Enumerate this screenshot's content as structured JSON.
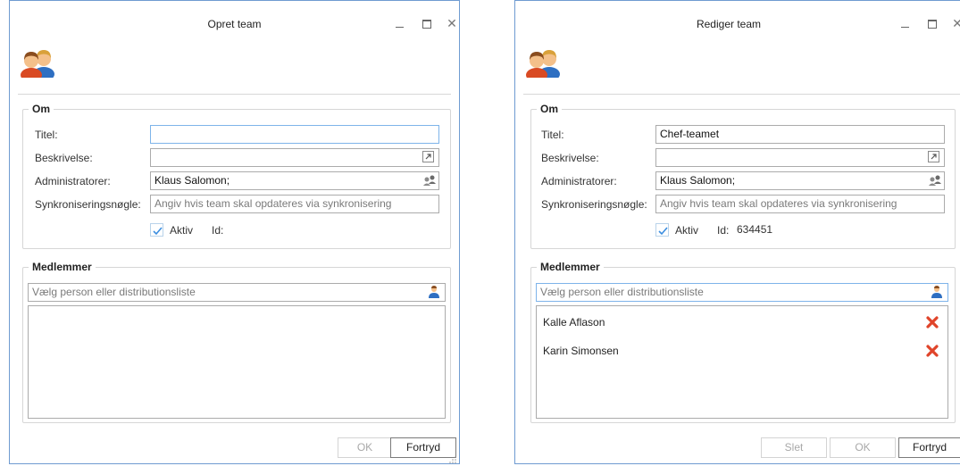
{
  "create_dialog": {
    "title": "Opret team",
    "close_glyph": "✕",
    "about": {
      "legend": "Om",
      "title_label": "Titel:",
      "title_value": "",
      "description_label": "Beskrivelse:",
      "description_value": "",
      "admins_label": "Administratorer:",
      "admins_value": "Klaus Salomon;",
      "sync_key_label": "Synkroniseringsnøgle:",
      "sync_key_placeholder": "Angiv hvis team skal opdateres via synkronisering",
      "active_label": "Aktiv",
      "active_checked": true,
      "id_label": "Id:",
      "id_value": ""
    },
    "members": {
      "legend": "Medlemmer",
      "search_placeholder": "Vælg person eller distributionsliste",
      "items": []
    },
    "buttons": {
      "ok": "OK",
      "cancel": "Fortryd"
    }
  },
  "edit_dialog": {
    "title": "Rediger team",
    "close_glyph": "✕",
    "about": {
      "legend": "Om",
      "title_label": "Titel:",
      "title_value": "Chef-teamet",
      "description_label": "Beskrivelse:",
      "description_value": "",
      "admins_label": "Administratorer:",
      "admins_value": "Klaus Salomon;",
      "sync_key_label": "Synkroniseringsnøgle:",
      "sync_key_placeholder": "Angiv hvis team skal opdateres via synkronisering",
      "active_label": "Aktiv",
      "active_checked": true,
      "id_label": "Id:",
      "id_value": "634451"
    },
    "members": {
      "legend": "Medlemmer",
      "search_placeholder": "Vælg person eller distributionsliste",
      "items": [
        {
          "name": "Kalle Aflason"
        },
        {
          "name": "Karin Simonsen"
        }
      ]
    },
    "buttons": {
      "delete": "Slet",
      "ok": "OK",
      "cancel": "Fortryd"
    }
  },
  "colors": {
    "window_border": "#6f9bd1",
    "focus_border": "#7eb4ea",
    "delete_red": "#e0442a",
    "check_blue": "#3b8ee0"
  },
  "icons": {
    "team": "team-icon",
    "expand": "expand-editor-icon",
    "admins": "people-picker-icon",
    "person": "person-icon",
    "delete": "delete-x-icon",
    "check": "checkmark-icon"
  }
}
